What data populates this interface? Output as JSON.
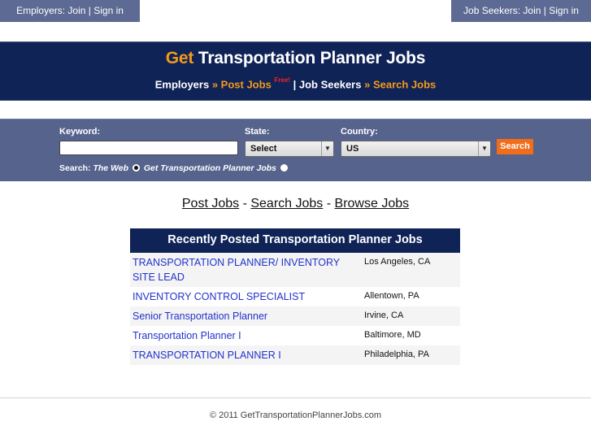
{
  "topbar": {
    "employers": {
      "prefix": "Employers: ",
      "join": "Join",
      "sep": " | ",
      "signin": "Sign in"
    },
    "seekers": {
      "prefix": "Job Seekers: ",
      "join": "Join",
      "sep": " | ",
      "signin": "Sign in"
    }
  },
  "header": {
    "title_accent": "Get",
    "title_rest": " Transportation Planner Jobs",
    "nav": {
      "employers": "Employers",
      "arrow": " » ",
      "post_jobs": "Post Jobs",
      "free_badge": "Free!",
      "divider": " | ",
      "job_seekers": "Job Seekers",
      "search_jobs": "Search Jobs"
    }
  },
  "search": {
    "keyword_label": "Keyword:",
    "keyword_value": "",
    "state_label": "State:",
    "state_value": "Select",
    "country_label": "Country:",
    "country_value": "US",
    "button": "Search",
    "scope_label": "Search: ",
    "scope_web": "The Web",
    "scope_site": "Get Transportation Planner Jobs",
    "scope_selected": "The Web"
  },
  "links": {
    "post": "Post Jobs",
    "sep": " - ",
    "search": "Search Jobs",
    "browse": "Browse Jobs"
  },
  "jobs": {
    "heading": "Recently Posted Transportation Planner Jobs",
    "rows": [
      {
        "title": "TRANSPORTATION PLANNER/ INVENTORY SITE LEAD",
        "location": "Los Angeles, CA"
      },
      {
        "title": "INVENTORY CONTROL SPECIALIST",
        "location": "Allentown, PA"
      },
      {
        "title": "Senior Transportation Planner",
        "location": "Irvine, CA"
      },
      {
        "title": "Transportation Planner I",
        "location": "Baltimore, MD"
      },
      {
        "title": "TRANSPORTATION PLANNER I",
        "location": "Philadelphia, PA"
      }
    ]
  },
  "footer": {
    "copyright": "© 2011 GetTransportationPlannerJobs.com"
  },
  "colors": {
    "navy": "#0f2357",
    "slate": "#56638d",
    "orange": "#f39a1c",
    "button_orange": "#f26d1a",
    "link_blue": "#2233cc",
    "free_red": "#ff2020"
  }
}
